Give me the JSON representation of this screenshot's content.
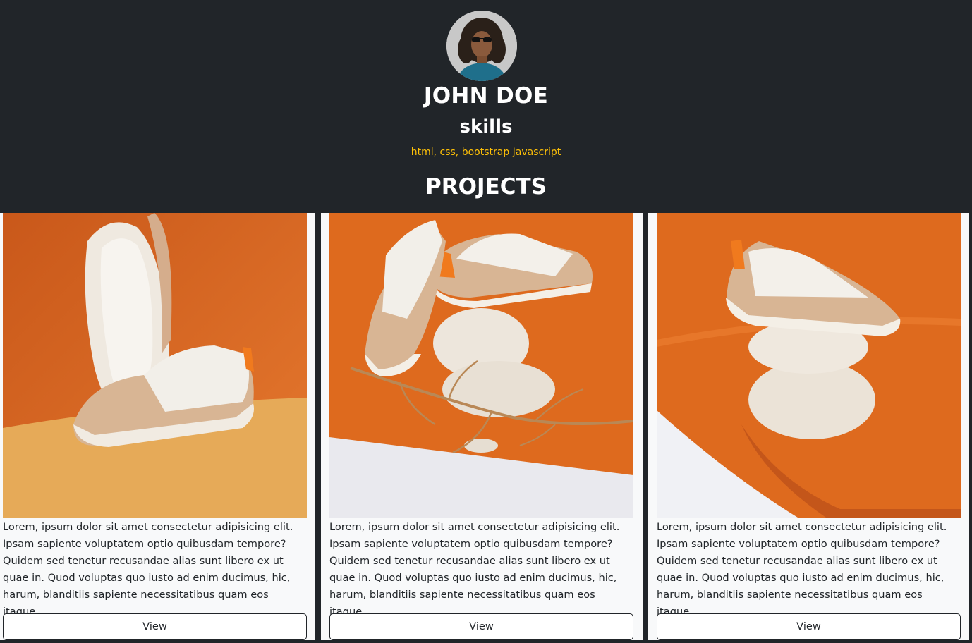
{
  "profile": {
    "name": "JOHN DOE",
    "skills_heading": "skills",
    "skills": "html, css, bootstrap Javascript",
    "projects_heading": "PROJECTS"
  },
  "projects": [
    {
      "image": "shoe-photo-orange-sole-up",
      "description": "Lorem, ipsum dolor sit amet consectetur adipisicing elit. Ipsam sapiente voluptatem optio quibusdam tempore? Quidem sed tenetur recusandae alias sunt libero ex ut quae in. Quod voluptas quo iusto ad enim ducimus, hic, harum, blanditiis sapiente necessitatibus quam eos itaque.",
      "button_label": "View"
    },
    {
      "image": "shoe-photo-stones-branch",
      "description": "Lorem, ipsum dolor sit amet consectetur adipisicing elit. Ipsam sapiente voluptatem optio quibusdam tempore? Quidem sed tenetur recusandae alias sunt libero ex ut quae in. Quod voluptas quo iusto ad enim ducimus, hic, harum, blanditiis sapiente necessitatibus quam eos itaque.",
      "button_label": "View"
    },
    {
      "image": "shoe-photo-stacked-stones",
      "description": "Lorem, ipsum dolor sit amet consectetur adipisicing elit. Ipsam sapiente voluptatem optio quibusdam tempore? Quidem sed tenetur recusandae alias sunt libero ex ut quae in. Quod voluptas quo iusto ad enim ducimus, hic, harum, blanditiis sapiente necessitatibus quam eos itaque.",
      "button_label": "View"
    }
  ],
  "colors": {
    "header_bg": "#212529",
    "accent": "#ffc107",
    "card_bg": "#f8f9fa",
    "photo_orange": "#de6a1e"
  }
}
